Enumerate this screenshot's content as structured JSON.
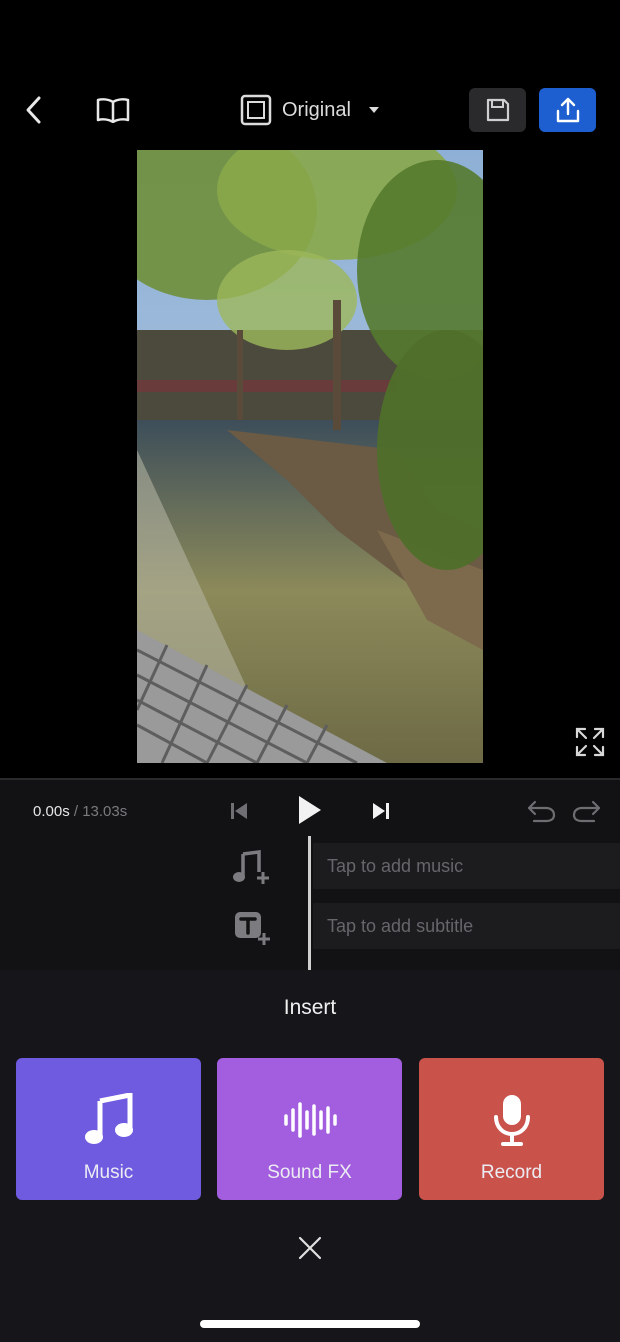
{
  "topbar": {
    "aspect_ratio_label": "Original",
    "export_color": "#1d5fd1"
  },
  "playback": {
    "current_time": "0.00s",
    "total_time": "/ 13.03s"
  },
  "tracks": {
    "music_placeholder": "Tap to add music",
    "subtitle_placeholder": "Tap to add subtitle"
  },
  "insert_panel": {
    "title": "Insert",
    "options": [
      {
        "label": "Music",
        "icon": "music-note-icon",
        "color": "#6e5be0"
      },
      {
        "label": "Sound FX",
        "icon": "waveform-icon",
        "color": "#a35ee0"
      },
      {
        "label": "Record",
        "icon": "microphone-icon",
        "color": "#c9524b"
      }
    ]
  }
}
